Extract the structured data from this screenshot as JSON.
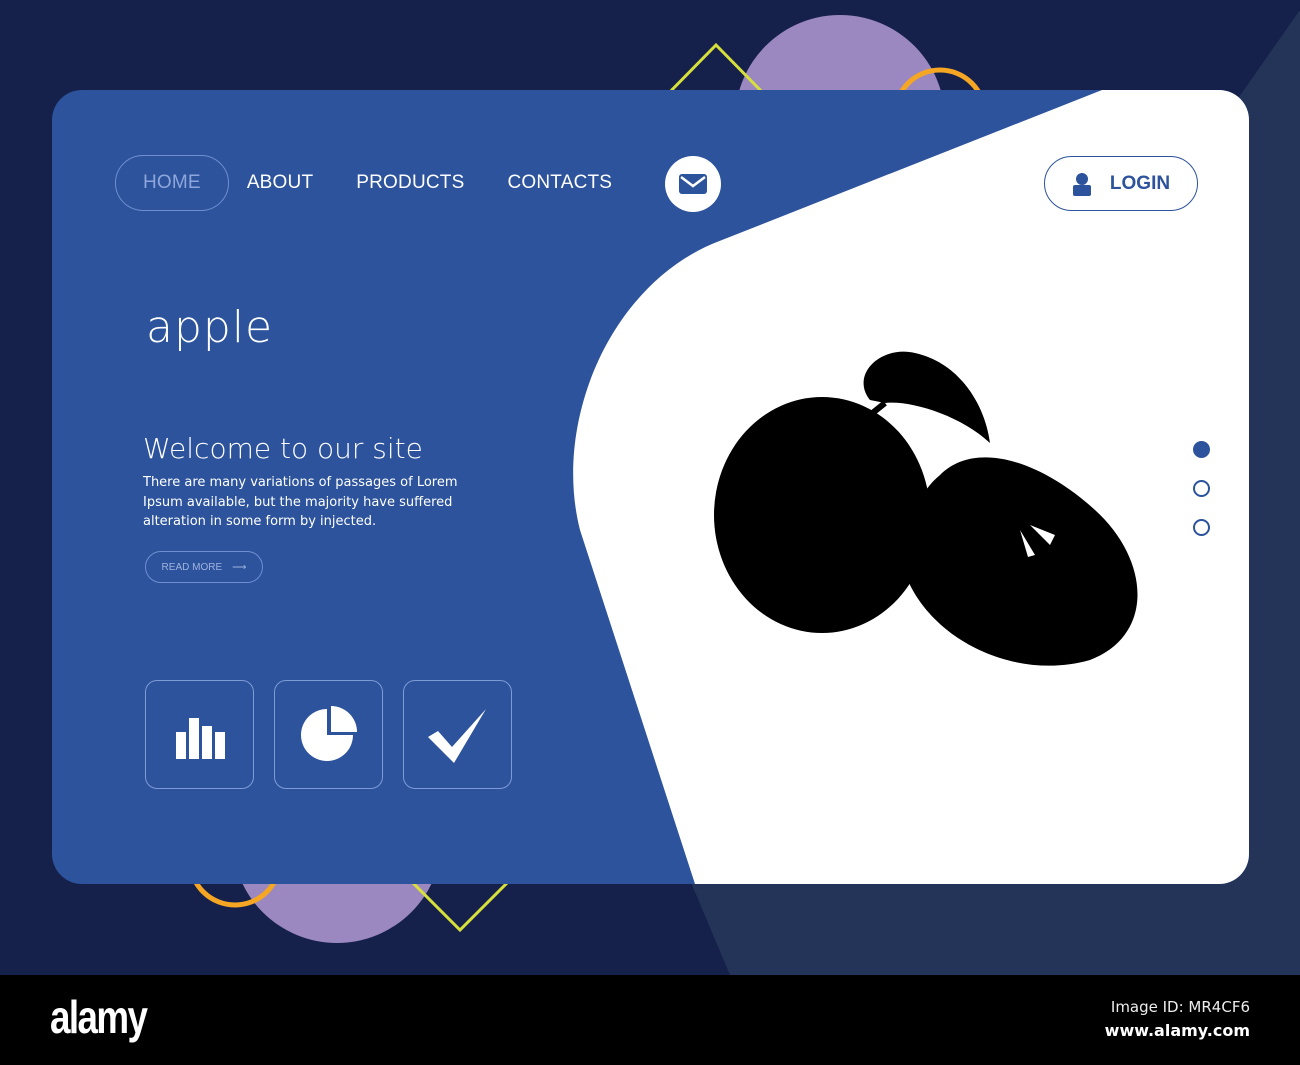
{
  "nav": {
    "items": [
      {
        "label": "HOME",
        "active": true
      },
      {
        "label": "ABOUT"
      },
      {
        "label": "PRODUCTS"
      },
      {
        "label": "CONTACTS"
      }
    ],
    "mail_icon": "envelope-icon"
  },
  "login": {
    "label": "LOGIN",
    "icon": "user-icon"
  },
  "hero": {
    "brand": "apple",
    "welcome": "Welcome to our site",
    "description": "There are many variations of passages of Lorem Ipsum available, but the majority have suffered alteration in some form by injected.",
    "read_more": "READ MORE"
  },
  "tiles": [
    {
      "icon": "bar-chart-icon"
    },
    {
      "icon": "pie-chart-icon"
    },
    {
      "icon": "checkmark-icon"
    }
  ],
  "slider": {
    "count": 3,
    "active": 0
  },
  "colors": {
    "background": "#15214a",
    "card": "#2c539c",
    "accent_purple": "#9b88c0",
    "accent_yellow": "#d7e03a",
    "accent_orange": "#f5a623"
  },
  "watermark": {
    "logo": "alamy",
    "image_id": "Image ID: MR4CF6",
    "url": "www.alamy.com"
  }
}
